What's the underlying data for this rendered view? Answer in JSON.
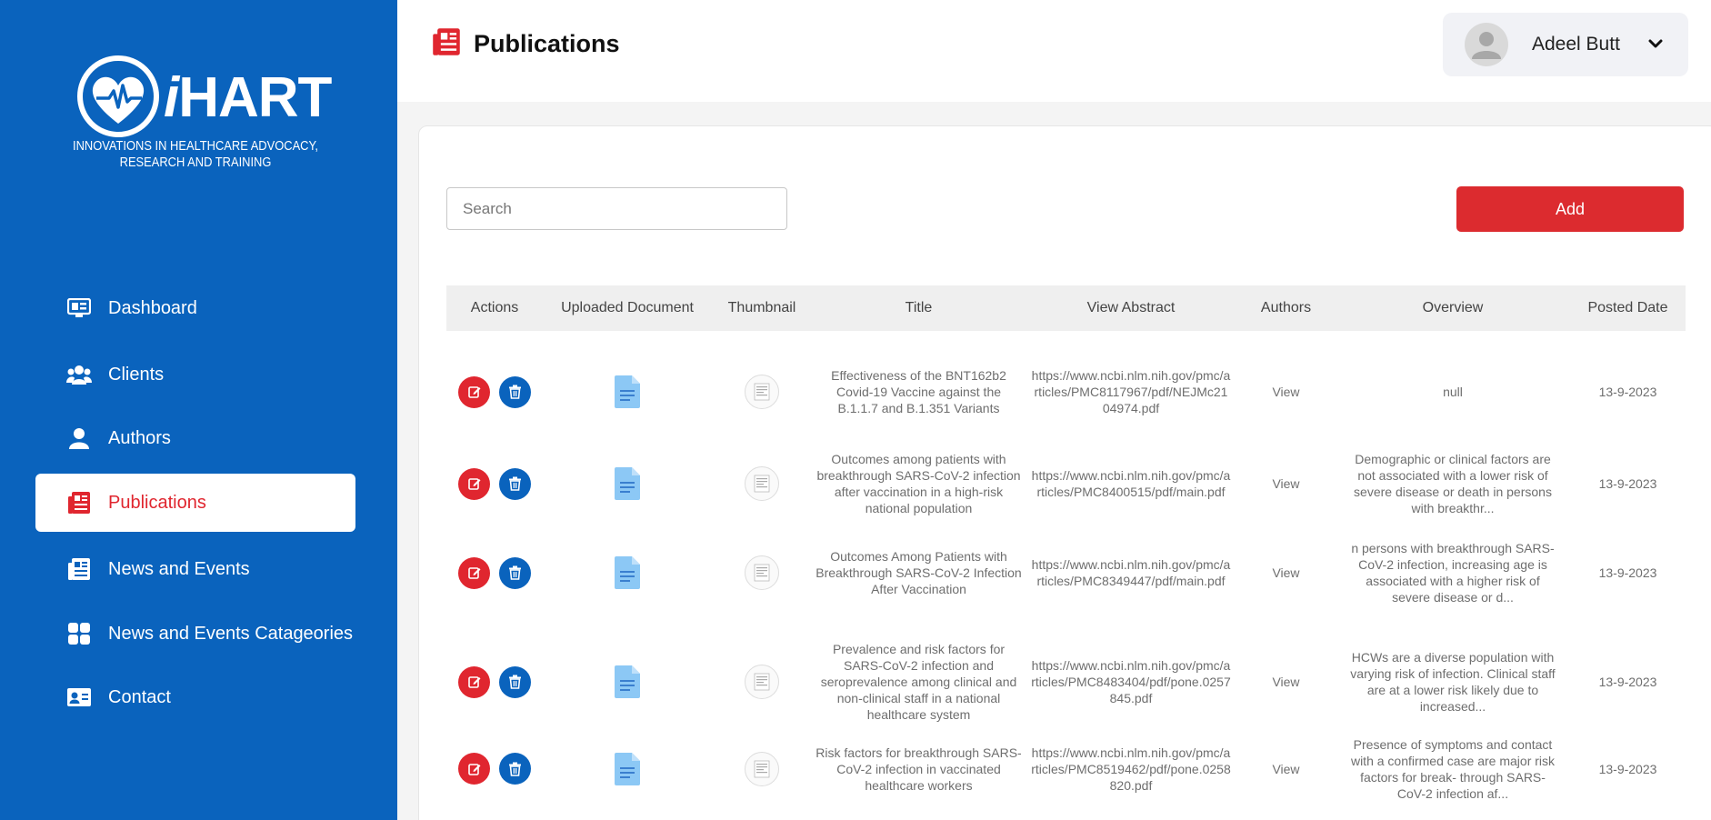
{
  "brand": {
    "name_i": "i",
    "name_rest": "HART",
    "subtitle_line1": "INNOVATIONS IN HEALTHCARE ADVOCACY,",
    "subtitle_line2": "RESEARCH AND TRAINING"
  },
  "sidebar": {
    "items": [
      {
        "label": "Dashboard",
        "icon": "dashboard-icon"
      },
      {
        "label": "Clients",
        "icon": "users-icon"
      },
      {
        "label": "Authors",
        "icon": "user-icon"
      },
      {
        "label": "Publications",
        "icon": "newspaper-icon",
        "active": true
      },
      {
        "label": "News and Events",
        "icon": "news-icon"
      },
      {
        "label": "News and Events Catageories",
        "icon": "grid-icon"
      },
      {
        "label": "Contact",
        "icon": "contact-card-icon"
      }
    ]
  },
  "header": {
    "title": "Publications",
    "user_name": "Adeel Butt"
  },
  "toolbar": {
    "search_placeholder": "Search",
    "add_label": "Add"
  },
  "table": {
    "columns": [
      "Actions",
      "Uploaded Document",
      "Thumbnail",
      "Title",
      "View Abstract",
      "Authors",
      "Overview",
      "Posted Date"
    ],
    "rows": [
      {
        "title": "Effectiveness of the BNT162b2 Covid-19 Vaccine against the B.1.1.7 and B.1.351 Variants",
        "abstract": "https://www.ncbi.nlm.nih.gov/pmc/articles/PMC8117967/pdf/NEJMc2104974.pdf",
        "authors": "View",
        "overview": "null",
        "date": "13-9-2023"
      },
      {
        "title": "Outcomes among patients with breakthrough SARS-CoV-2 infection after vaccination in a high-risk national population",
        "abstract": "https://www.ncbi.nlm.nih.gov/pmc/articles/PMC8400515/pdf/main.pdf",
        "authors": "View",
        "overview": "Demographic or clinical factors are not associated with a lower risk of severe disease or death in persons with breakthr...",
        "date": "13-9-2023"
      },
      {
        "title": "Outcomes Among Patients with Breakthrough SARS-CoV-2 Infection After Vaccination",
        "abstract": "https://www.ncbi.nlm.nih.gov/pmc/articles/PMC8349447/pdf/main.pdf",
        "authors": "View",
        "overview": "n persons with breakthrough SARS-CoV-2 infection, increasing age is associated with a higher risk of severe disease or d...",
        "date": "13-9-2023"
      },
      {
        "title": "Prevalence and risk factors for SARS-CoV-2 infection and seroprevalence among clinical and non-clinical staff in a national healthcare system",
        "abstract": "https://www.ncbi.nlm.nih.gov/pmc/articles/PMC8483404/pdf/pone.0257845.pdf",
        "authors": "View",
        "overview": "HCWs are a diverse population with varying risk of infection. Clinical staff are at a lower risk likely due to increased...",
        "date": "13-9-2023"
      },
      {
        "title": "Risk factors for breakthrough SARS-CoV-2 infection in vaccinated healthcare workers",
        "abstract": "https://www.ncbi.nlm.nih.gov/pmc/articles/PMC8519462/pdf/pone.0258820.pdf",
        "authors": "View",
        "overview": "Presence of symptoms and contact with a confirmed case are major risk factors for break- through SARS-CoV-2 infection af...",
        "date": "13-9-2023"
      }
    ]
  },
  "colors": {
    "sidebar": "#0a63bd",
    "accent_red": "#dc2b2f",
    "doc_icon": "#8cc8f5"
  }
}
